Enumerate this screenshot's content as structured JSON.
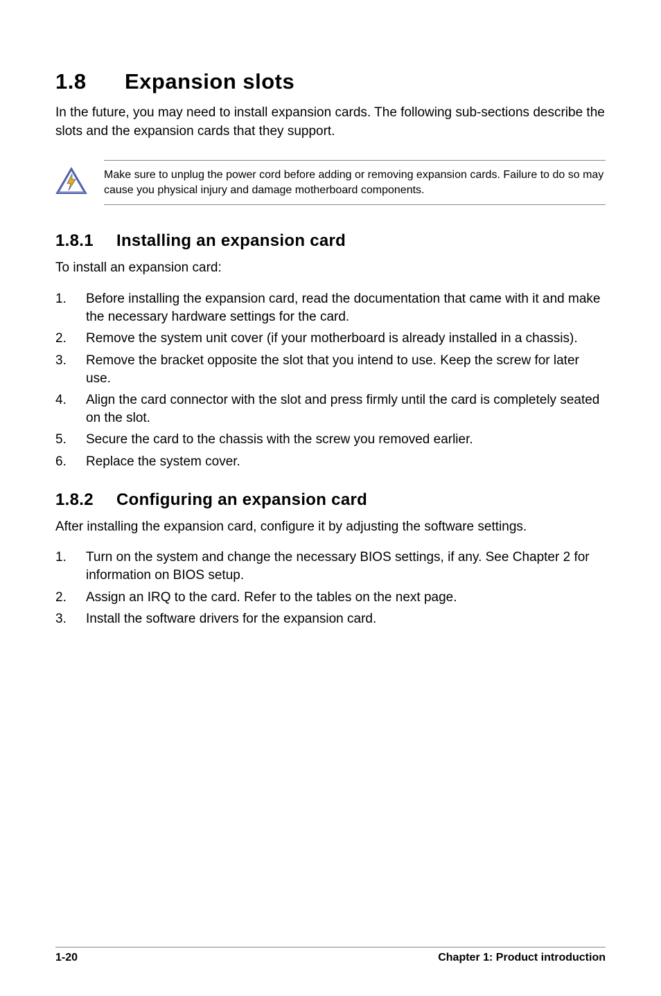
{
  "heading": {
    "number": "1.8",
    "title": "Expansion slots"
  },
  "intro": "In the future, you may need to install expansion cards. The following sub-sections describe the slots and the expansion cards that they support.",
  "callout": {
    "icon_name": "warning-bolt-icon",
    "text": "Make sure to unplug the power cord before adding or removing expansion cards. Failure to do so may cause you physical injury and damage motherboard components."
  },
  "section_install": {
    "number": "1.8.1",
    "title": "Installing an expansion card",
    "lead": "To install an expansion card:",
    "steps": [
      "Before installing the expansion card, read the documentation that came with it and make the necessary hardware settings for the card.",
      "Remove the system unit cover (if your motherboard is already installed in a chassis).",
      "Remove the bracket opposite the slot that you intend to use. Keep the screw for later use.",
      "Align the card connector with the slot and press firmly until the card is completely seated on the slot.",
      "Secure the card to the chassis with the screw you removed earlier.",
      "Replace the system cover."
    ]
  },
  "section_configure": {
    "number": "1.8.2",
    "title": "Configuring an expansion card",
    "lead": "After installing the expansion card, configure it by adjusting the software settings.",
    "steps": [
      "Turn on the system and change the necessary BIOS settings, if any. See Chapter 2 for information on BIOS setup.",
      "Assign an IRQ to the card. Refer to the tables on the next page.",
      "Install the software drivers for the expansion card."
    ]
  },
  "footer": {
    "page": "1-20",
    "chapter": "Chapter 1: Product introduction"
  }
}
